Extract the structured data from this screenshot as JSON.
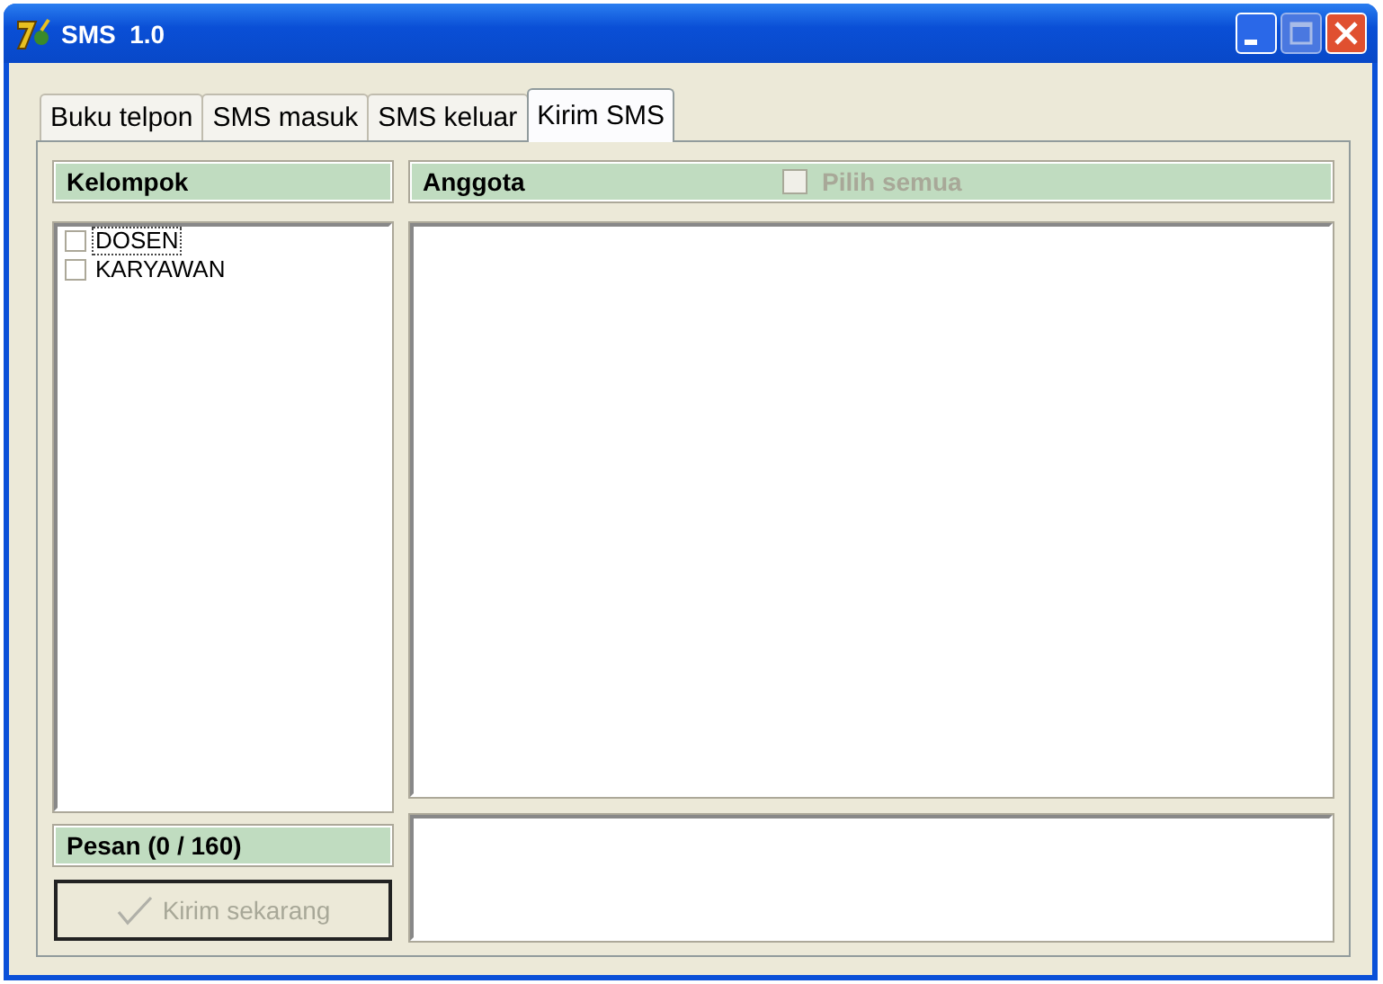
{
  "window": {
    "title": "SMS  1.0"
  },
  "tabs": [
    {
      "label": "Buku telpon",
      "selected": false
    },
    {
      "label": "SMS masuk",
      "selected": false
    },
    {
      "label": "SMS keluar",
      "selected": false
    },
    {
      "label": "Kirim SMS",
      "selected": true
    }
  ],
  "groups": {
    "header": "Kelompok",
    "items": [
      {
        "label": "DOSEN",
        "checked": false,
        "focused": true
      },
      {
        "label": "KARYAWAN",
        "checked": false,
        "focused": false
      }
    ]
  },
  "members": {
    "header": "Anggota",
    "select_all": {
      "label": "Pilih semua",
      "checked": false,
      "disabled": true
    }
  },
  "message": {
    "header": "Pesan (0 / 160)"
  },
  "send_button": {
    "label": "Kirim sekarang",
    "disabled": true
  }
}
